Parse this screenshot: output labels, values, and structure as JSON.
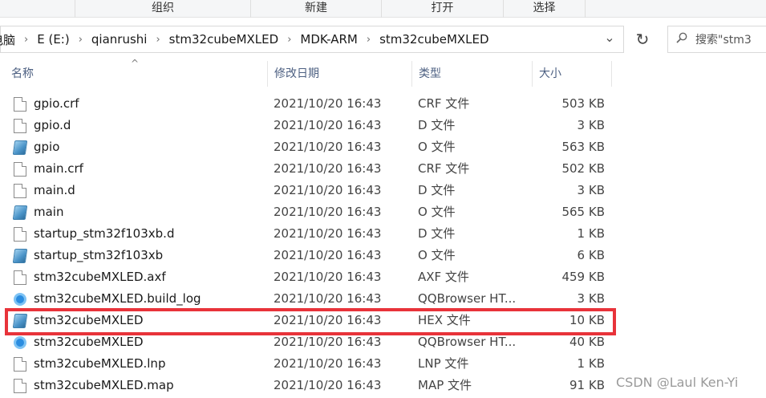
{
  "ribbon": {
    "groups": [
      "组织",
      "新建",
      "打开",
      "选择"
    ]
  },
  "address": {
    "breadcrumbs": [
      "电脑",
      "E (E:)",
      "qianrushi",
      "stm32cubeMXLED",
      "MDK-ARM",
      "stm32cubeMXLED"
    ],
    "separator": "›",
    "dropdown_glyph": "⌄",
    "refresh_glyph": "↻"
  },
  "search": {
    "placeholder": "搜索\"stm3",
    "icon": "search-icon"
  },
  "columns": {
    "name": "名称",
    "date": "修改日期",
    "type": "类型",
    "size": "大小",
    "sort_glyph": "^"
  },
  "files": [
    {
      "name": "gpio.crf",
      "date": "2021/10/20 16:43",
      "type": "CRF 文件",
      "size": "503 KB",
      "icon": "document-icon"
    },
    {
      "name": "gpio.d",
      "date": "2021/10/20 16:43",
      "type": "D 文件",
      "size": "3 KB",
      "icon": "document-icon"
    },
    {
      "name": "gpio",
      "date": "2021/10/20 16:43",
      "type": "O 文件",
      "size": "563 KB",
      "icon": "object-file-icon"
    },
    {
      "name": "main.crf",
      "date": "2021/10/20 16:43",
      "type": "CRF 文件",
      "size": "502 KB",
      "icon": "document-icon"
    },
    {
      "name": "main.d",
      "date": "2021/10/20 16:43",
      "type": "D 文件",
      "size": "3 KB",
      "icon": "document-icon"
    },
    {
      "name": "main",
      "date": "2021/10/20 16:43",
      "type": "O 文件",
      "size": "565 KB",
      "icon": "object-file-icon"
    },
    {
      "name": "startup_stm32f103xb.d",
      "date": "2021/10/20 16:43",
      "type": "D 文件",
      "size": "1 KB",
      "icon": "document-icon"
    },
    {
      "name": "startup_stm32f103xb",
      "date": "2021/10/20 16:43",
      "type": "O 文件",
      "size": "6 KB",
      "icon": "object-file-icon"
    },
    {
      "name": "stm32cubeMXLED.axf",
      "date": "2021/10/20 16:43",
      "type": "AXF 文件",
      "size": "459 KB",
      "icon": "document-icon"
    },
    {
      "name": "stm32cubeMXLED.build_log",
      "date": "2021/10/20 16:43",
      "type": "QQBrowser HT...",
      "size": "3 KB",
      "icon": "qqbrowser-icon"
    },
    {
      "name": "stm32cubeMXLED",
      "date": "2021/10/20 16:43",
      "type": "HEX 文件",
      "size": "10 KB",
      "icon": "object-file-icon"
    },
    {
      "name": "stm32cubeMXLED",
      "date": "2021/10/20 16:43",
      "type": "QQBrowser HT...",
      "size": "40 KB",
      "icon": "qqbrowser-icon"
    },
    {
      "name": "stm32cubeMXLED.lnp",
      "date": "2021/10/20 16:43",
      "type": "LNP 文件",
      "size": "1 KB",
      "icon": "document-icon"
    },
    {
      "name": "stm32cubeMXLED.map",
      "date": "2021/10/20 16:43",
      "type": "MAP 文件",
      "size": "91 KB",
      "icon": "document-icon"
    }
  ],
  "highlight": {
    "color": "#e8333a",
    "row_index": 10
  },
  "watermark": "CSDN @Laul Ken-Yi"
}
